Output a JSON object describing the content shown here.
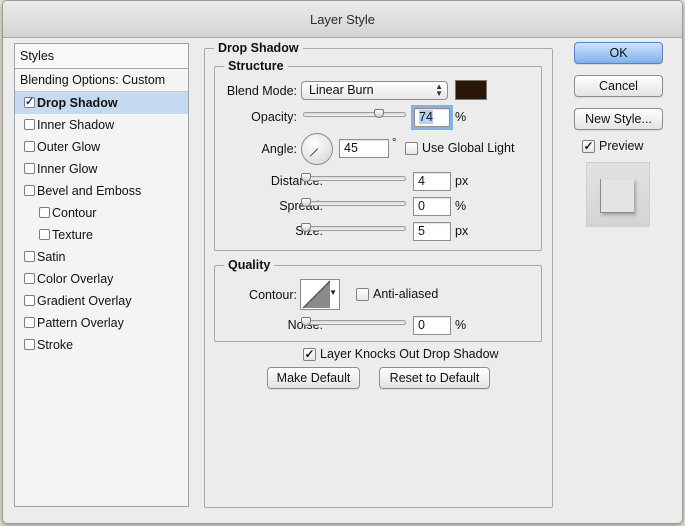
{
  "window": {
    "title": "Layer Style"
  },
  "styles": {
    "header": "Styles",
    "items": [
      {
        "label": "Blending Options: Custom",
        "type": "header"
      },
      {
        "label": "Drop Shadow",
        "checked": true,
        "selected": true
      },
      {
        "label": "Inner Shadow",
        "checked": false
      },
      {
        "label": "Outer Glow",
        "checked": false
      },
      {
        "label": "Inner Glow",
        "checked": false
      },
      {
        "label": "Bevel and Emboss",
        "checked": false
      },
      {
        "label": "Contour",
        "checked": false,
        "sub": true
      },
      {
        "label": "Texture",
        "checked": false,
        "sub": true
      },
      {
        "label": "Satin",
        "checked": false
      },
      {
        "label": "Color Overlay",
        "checked": false
      },
      {
        "label": "Gradient Overlay",
        "checked": false
      },
      {
        "label": "Pattern Overlay",
        "checked": false
      },
      {
        "label": "Stroke",
        "checked": false
      }
    ]
  },
  "drop_shadow": {
    "title": "Drop Shadow",
    "structure": {
      "title": "Structure",
      "blend_mode_label": "Blend Mode:",
      "blend_mode_value": "Linear Burn",
      "color": "#2b1608",
      "opacity_label": "Opacity:",
      "opacity_value": "74",
      "opacity_level": 0.74,
      "opacity_unit": "%",
      "angle_label": "Angle:",
      "angle_value": "45",
      "angle_unit": "°",
      "global_light_label": "Use Global Light",
      "global_light_checked": false,
      "distance_label": "Distance:",
      "distance_value": "4",
      "distance_unit": "px",
      "spread_label": "Spread:",
      "spread_value": "0",
      "spread_unit": "%",
      "size_label": "Size:",
      "size_value": "5",
      "size_unit": "px"
    },
    "quality": {
      "title": "Quality",
      "contour_label": "Contour:",
      "anti_aliased_label": "Anti-aliased",
      "anti_aliased_checked": false,
      "noise_label": "Noise:",
      "noise_value": "0",
      "noise_unit": "%"
    },
    "knockout_label": "Layer Knocks Out Drop Shadow",
    "knockout_checked": true,
    "make_default_label": "Make Default",
    "reset_default_label": "Reset to Default"
  },
  "actions": {
    "ok_label": "OK",
    "cancel_label": "Cancel",
    "new_style_label": "New Style...",
    "preview_label": "Preview",
    "preview_checked": true
  },
  "colors": {
    "accent": "#80b1ec",
    "selection": "#c5d9f0"
  }
}
